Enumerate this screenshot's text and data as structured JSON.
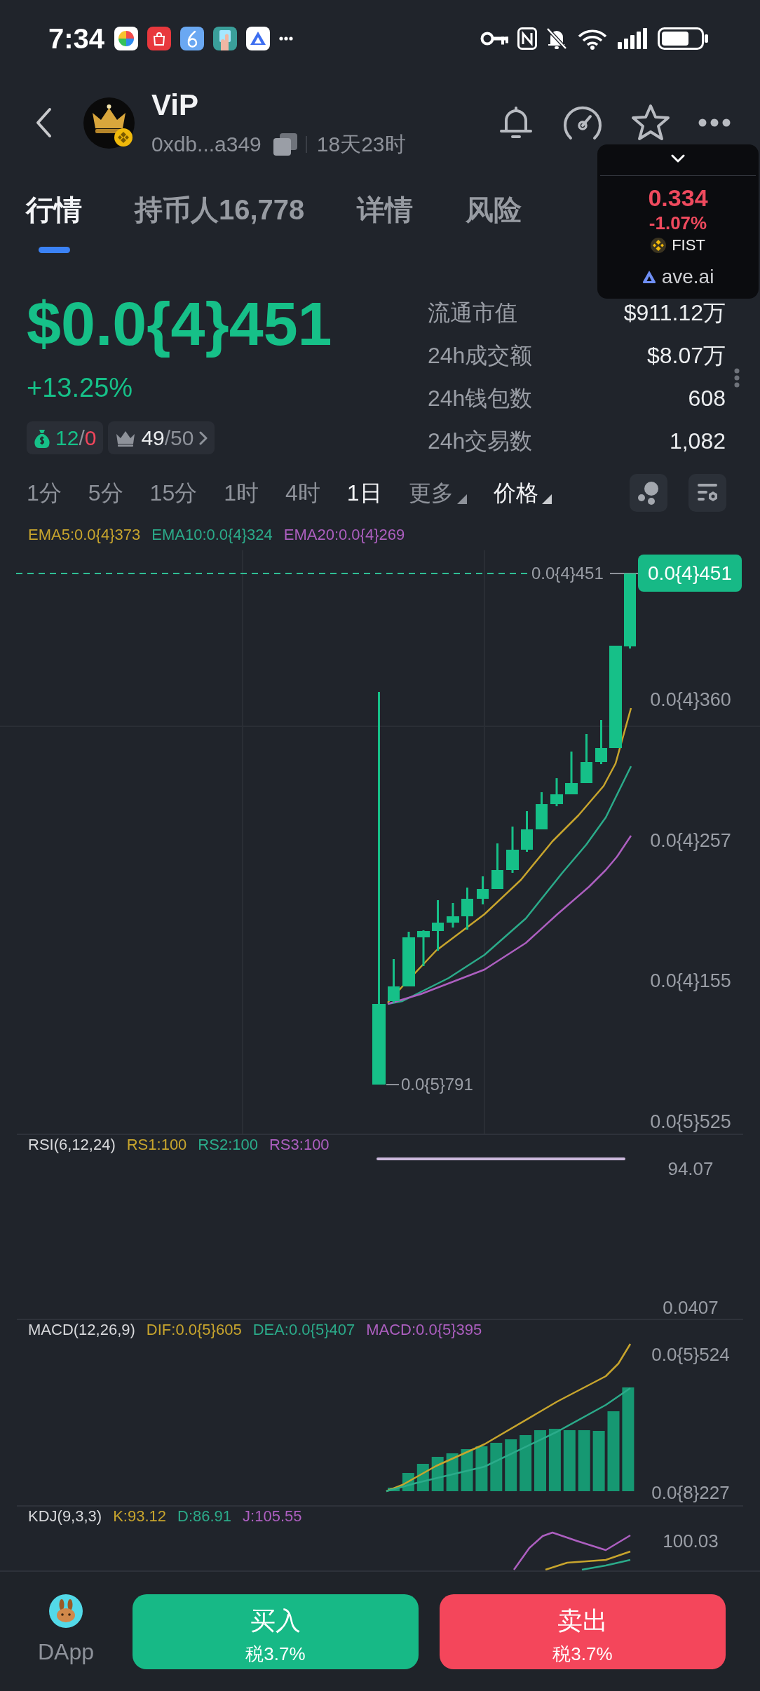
{
  "status_bar": {
    "time": "7:34"
  },
  "header": {
    "title": "ViP",
    "address": "0xdb...a349",
    "age": "18天23时"
  },
  "tabs": [
    {
      "label": "行情",
      "selected": true
    },
    {
      "label": "持币人16,778",
      "selected": false
    },
    {
      "label": "详情",
      "selected": false
    },
    {
      "label": "风险",
      "selected": false
    }
  ],
  "floating_widget": {
    "price": "0.334",
    "change": "-1.07%",
    "symbol": "FIST",
    "source": "ave.ai"
  },
  "price": {
    "value": "$0.0{4}451",
    "change": "+13.25%"
  },
  "badges": [
    {
      "kind": "money-bag",
      "parts": [
        {
          "text": "12",
          "kind": "up"
        },
        {
          "text": "/",
          "kind": "muted"
        },
        {
          "text": "0",
          "kind": "down"
        }
      ]
    },
    {
      "kind": "crown",
      "parts": [
        {
          "text": "49",
          "kind": "plain"
        },
        {
          "text": "/50",
          "kind": "muted"
        }
      ]
    }
  ],
  "stats": [
    {
      "label": "流通市值",
      "value": "$911.12万"
    },
    {
      "label": "24h成交额",
      "value": "$8.07万"
    },
    {
      "label": "24h钱包数",
      "value": "608"
    },
    {
      "label": "24h交易数",
      "value": "1,082"
    }
  ],
  "intervals": [
    {
      "label": "1分",
      "selected": false
    },
    {
      "label": "5分",
      "selected": false
    },
    {
      "label": "15分",
      "selected": false
    },
    {
      "label": "1时",
      "selected": false
    },
    {
      "label": "4时",
      "selected": false
    },
    {
      "label": "1日",
      "selected": true
    }
  ],
  "menus": [
    {
      "label": "更多",
      "selected": false
    },
    {
      "label": "价格",
      "selected": true
    }
  ],
  "chart": {
    "legend": [
      {
        "text": "EMA5:0.0{4}373",
        "color": "#c8a52d"
      },
      {
        "text": "EMA10:0.0{4}324",
        "color": "#2bab8a"
      },
      {
        "text": "EMA20:0.0{4}269",
        "color": "#ad5fc0"
      }
    ],
    "last_price_label": "0.0{4}451",
    "price_tag": "0.0{4}451",
    "axis_labels": [
      "0.0{4}360",
      "0.0{4}257",
      "0.0{4}155",
      "0.0{5}525"
    ],
    "low_label": "0.0{5}791"
  },
  "rsi": {
    "title": "RSI(6,12,24)",
    "legend": [
      {
        "text": "RS1:100",
        "color": "#c8a52d"
      },
      {
        "text": "RS2:100",
        "color": "#2bab8a"
      },
      {
        "text": "RS3:100",
        "color": "#ad5fc0"
      }
    ],
    "axis_labels": [
      "94.07",
      "0.0407"
    ]
  },
  "macd": {
    "title": "MACD(12,26,9)",
    "legend": [
      {
        "text": "DIF:0.0{5}605",
        "color": "#c8a52d"
      },
      {
        "text": "DEA:0.0{5}407",
        "color": "#2bab8a"
      },
      {
        "text": "MACD:0.0{5}395",
        "color": "#ad5fc0"
      }
    ],
    "axis_labels": [
      "0.0{5}524",
      "0.0{8}227"
    ]
  },
  "kdj": {
    "title": "KDJ(9,3,3)",
    "legend": [
      {
        "text": "K:93.12",
        "color": "#c8a52d"
      },
      {
        "text": "D:86.91",
        "color": "#2bab8a"
      },
      {
        "text": "J:105.55",
        "color": "#ad5fc0"
      }
    ],
    "axis_labels": [
      "100.03"
    ]
  },
  "bottom_bar": {
    "dapp": "DApp",
    "buttons": [
      {
        "kind": "buy",
        "label": "买入",
        "tax": "税3.7%"
      },
      {
        "kind": "sell",
        "label": "卖出",
        "tax": "税3.7%"
      }
    ]
  }
}
